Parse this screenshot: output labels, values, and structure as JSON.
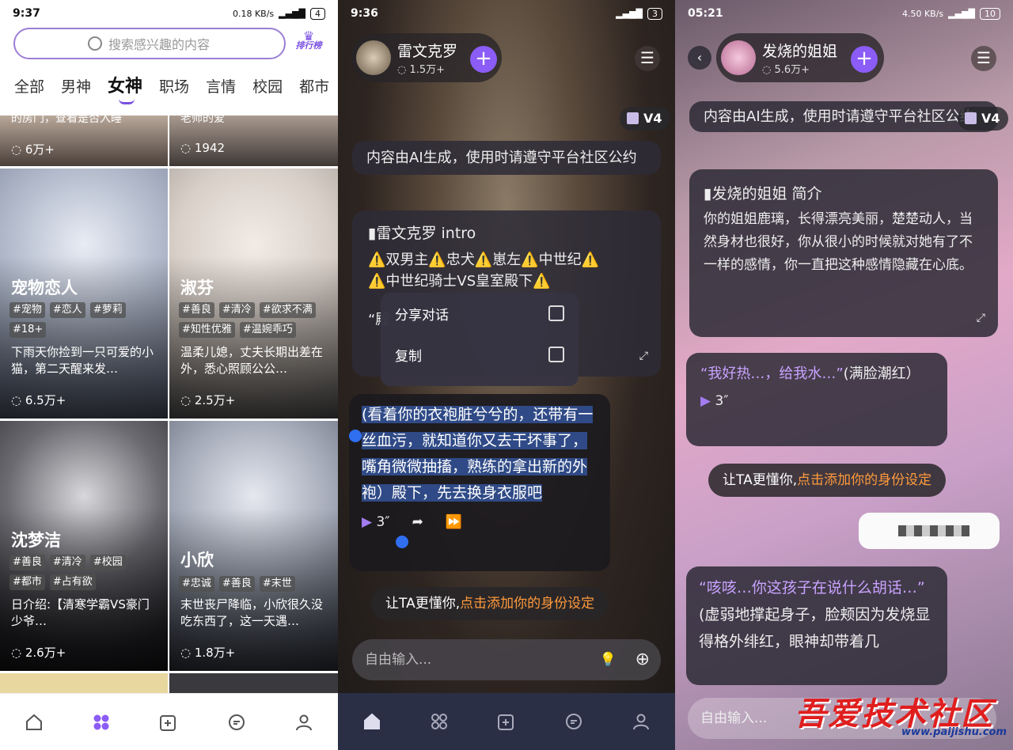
{
  "phone1": {
    "status": {
      "time": "9:37",
      "net": "0.18 KB/s",
      "battery": "4"
    },
    "search_placeholder": "搜索感兴趣的内容",
    "rank_label": "排行榜",
    "tabs": [
      "全部",
      "男神",
      "女神",
      "职场",
      "言情",
      "校园",
      "都市"
    ],
    "top_partial": {
      "left_text": "的房门，查看是否入睡",
      "left_count": "6万+",
      "right_text": "老师的爱",
      "right_count": "1942"
    },
    "cards": [
      {
        "name": "宠物恋人",
        "tags": [
          "#宠物",
          "#恋人",
          "#萝莉",
          "#18+"
        ],
        "desc": "下雨天你捡到一只可爱的小猫，第二天醒来发…",
        "count": "6.5万+"
      },
      {
        "name": "淑芬",
        "tags": [
          "#善良",
          "#清冷",
          "#欲求不满",
          "#知性优雅",
          "#温婉乖巧"
        ],
        "desc": "温柔儿媳，丈夫长期出差在外，悉心照顾公公…",
        "count": "2.5万+"
      },
      {
        "name": "沈梦洁",
        "tags": [
          "#善良",
          "#清冷",
          "#校园",
          "#都市",
          "#占有欲"
        ],
        "desc": "日介绍:【清寒学霸VS豪门少爷…",
        "count": "2.6万+"
      },
      {
        "name": "小欣",
        "tags": [
          "#忠诚",
          "#善良",
          "#末世"
        ],
        "desc": "末世丧尸降临，小欣很久没吃东西了，这一天遇…",
        "count": "1.8万+"
      }
    ]
  },
  "phone2": {
    "status": {
      "time": "9:36"
    },
    "character": {
      "name": "雷文克罗",
      "followers": "1.5万+"
    },
    "version": "V4",
    "ai_notice": "内容由AI生成，使用时请遵守平台社区公约",
    "intro_title": "雷文克罗 intro",
    "intro_line1": "⚠️双男主⚠️忠犬⚠️崽左⚠️中世纪⚠️",
    "intro_line2": "⚠️中世纪骑士VS皇室殿下⚠️",
    "intro_quote": "“殿",
    "context_menu": [
      "分享对话",
      "复制"
    ],
    "selected_message": "(看着你的衣袍脏兮兮的，还带有一丝血污，就知道你又去干坏事了，嘴角微微抽搐，熟练的拿出新的外袍）殿下，先去换身衣服吧",
    "audio_duration": "3″",
    "suggest_prefix": "让TA更懂你,",
    "suggest_link": "点击添加你的身份设定",
    "input_placeholder": "自由输入..."
  },
  "phone3": {
    "status": {
      "time": "05:21",
      "net": "4.50 KB/s",
      "battery": "10"
    },
    "character": {
      "name": "发烧的姐姐",
      "followers": "5.6万+"
    },
    "version": "V4",
    "ai_notice": "内容由AI生成，使用时请遵守平台社区公约",
    "intro_title": "发烧的姐姐  简介",
    "intro_text": "你的姐姐鹿璃，长得漂亮美丽，楚楚动人，当然身材也很好，你从很小的时候就对她有了不一样的感情，你一直把这种感情隐藏在心底。",
    "msg1_quote": "“我好热…，给我水…”",
    "msg1_action": "(满脸潮红）",
    "msg1_duration": "3″",
    "suggest_prefix": "让TA更懂你,",
    "suggest_link": "点击添加你的身份设定",
    "msg2_quote": "“咳咳…你这孩子在说什么胡话…”",
    "msg2_action": "(虚弱地撑起身子，脸颊因为发烧显得格外绯红，眼神却带着几",
    "input_placeholder": "自由输入...",
    "watermark": "吾爱技术社区",
    "watermark_url": "www.paijishu.com"
  }
}
